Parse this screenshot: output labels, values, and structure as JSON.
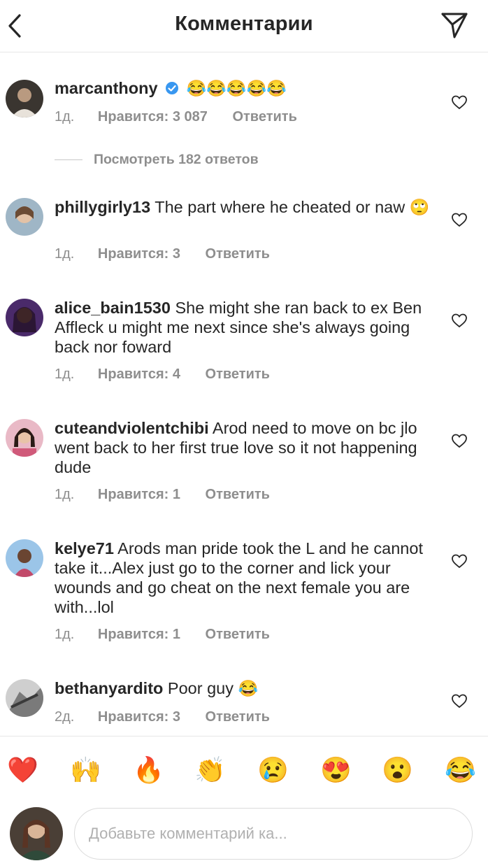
{
  "header": {
    "title": "Комментарии",
    "back_icon": "chevron-left-icon",
    "share_icon": "paper-plane-icon"
  },
  "comments": [
    {
      "username": "marcanthony",
      "verified": true,
      "text": "",
      "emoji": "😂😂😂😂😂",
      "time": "1д.",
      "likes": "Нравится: 3 087",
      "reply": "Ответить"
    },
    {
      "username": "phillygirly13",
      "verified": false,
      "text": " The part where he cheated or naw ",
      "emoji": "🙄",
      "time": "1д.",
      "likes": "Нравится: 3",
      "reply": "Ответить"
    },
    {
      "username": "alice_bain1530",
      "verified": false,
      "text": " She might she ran back to ex Ben Affleck u might me next since she's always going back nor foward",
      "emoji": "",
      "time": "1д.",
      "likes": "Нравится: 4",
      "reply": "Ответить"
    },
    {
      "username": "cuteandviolentchibi",
      "verified": false,
      "text": " Arod need to move on bc jlo went back to her first true love so it not happening dude",
      "emoji": "",
      "time": "1д.",
      "likes": "Нравится: 1",
      "reply": "Ответить"
    },
    {
      "username": "kelye71",
      "verified": false,
      "text": " Arods man pride took the L and he cannot take it...Alex just go to the corner and lick your wounds and go cheat on the next female you are with...lol",
      "emoji": "",
      "time": "1д.",
      "likes": "Нравится: 1",
      "reply": "Ответить"
    },
    {
      "username": "bethanyardito",
      "verified": false,
      "text": " Poor guy ",
      "emoji": "😂",
      "time": "2д.",
      "likes": "Нравится: 3",
      "reply": "Ответить"
    }
  ],
  "view_replies": "Посмотреть 182 ответов",
  "emoji_bar": [
    "❤️",
    "🙌",
    "🔥",
    "👏",
    "😢",
    "😍",
    "😮",
    "😂"
  ],
  "composer": {
    "placeholder": "Добавьте комментарий ка..."
  },
  "colors": {
    "text": "#262626",
    "secondary": "#8e8e8e",
    "verified": "#3897f0",
    "divider": "#e6e6e6"
  }
}
